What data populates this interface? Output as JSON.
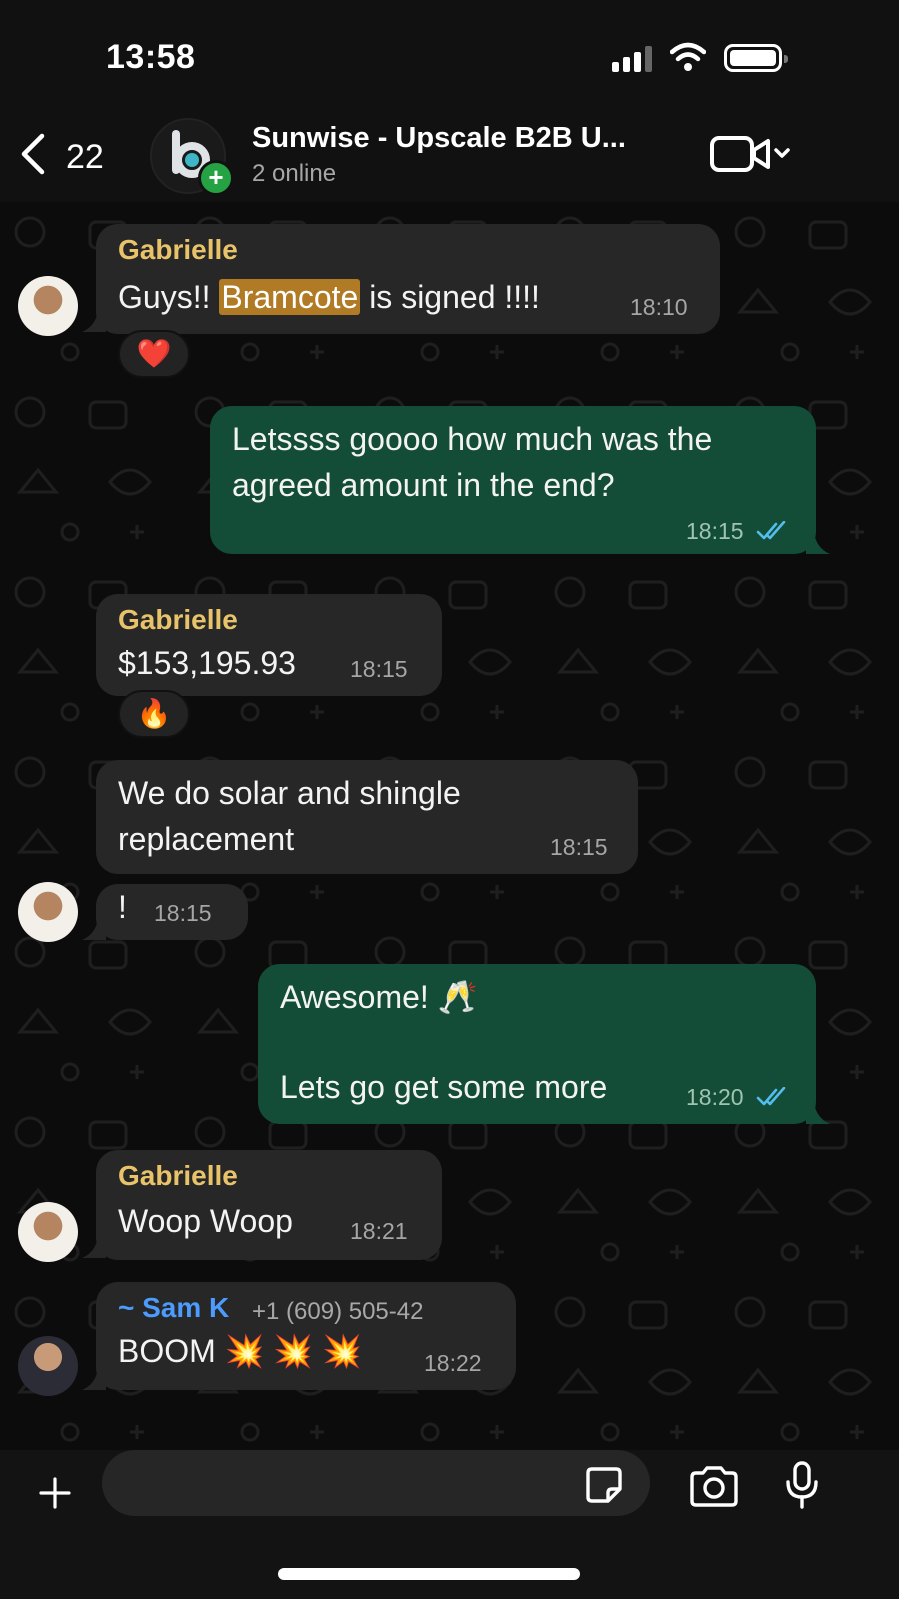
{
  "status_bar": {
    "time": "13:58"
  },
  "header": {
    "back_count": "22",
    "group_name": "Sunwise - Upscale B2B U...",
    "online": "2 online",
    "icons": [
      "back-chevron-icon",
      "add-member-icon",
      "video-call-icon",
      "chevron-down-icon"
    ]
  },
  "messages": [
    {
      "id": 1,
      "direction": "in",
      "sender": "Gabrielle",
      "text_before": "Guys!! ",
      "highlight": "Bramcote",
      "text_after": " is signed !!!!",
      "time": "18:10",
      "reaction": "❤️"
    },
    {
      "id": 2,
      "direction": "out",
      "line1": "Letssss goooo how much was the",
      "line2": "agreed amount in the end?",
      "time": "18:15",
      "status": "read"
    },
    {
      "id": 3,
      "direction": "in",
      "sender": "Gabrielle",
      "text": "$153,195.93",
      "time": "18:15",
      "reaction": "🔥"
    },
    {
      "id": 4,
      "direction": "in",
      "line1": "We do solar and shingle",
      "line2": "replacement",
      "time": "18:15"
    },
    {
      "id": 5,
      "direction": "in",
      "text": "!",
      "time": "18:15"
    },
    {
      "id": 6,
      "direction": "out",
      "line1": "Awesome! 🥂",
      "line2": "Lets go get some more",
      "time": "18:20",
      "status": "read"
    },
    {
      "id": 7,
      "direction": "in",
      "sender": "Gabrielle",
      "text": "Woop Woop",
      "time": "18:21"
    },
    {
      "id": 8,
      "direction": "in",
      "sender": "~ Sam K",
      "phone": "+1 (609) 505-42",
      "text": "BOOM 💥 💥 💥",
      "time": "18:22"
    }
  ],
  "composer": {
    "placeholder": "",
    "icons": [
      "plus-icon",
      "sticker-icon",
      "camera-icon",
      "microphone-icon"
    ]
  },
  "colors": {
    "incoming_bubble": "#272727",
    "outgoing_bubble": "#144d37",
    "sender_gabrielle": "#e8c36a",
    "sender_sam": "#4c9bff",
    "read_ticks": "#53bdeb",
    "highlight": "#b17a24"
  }
}
